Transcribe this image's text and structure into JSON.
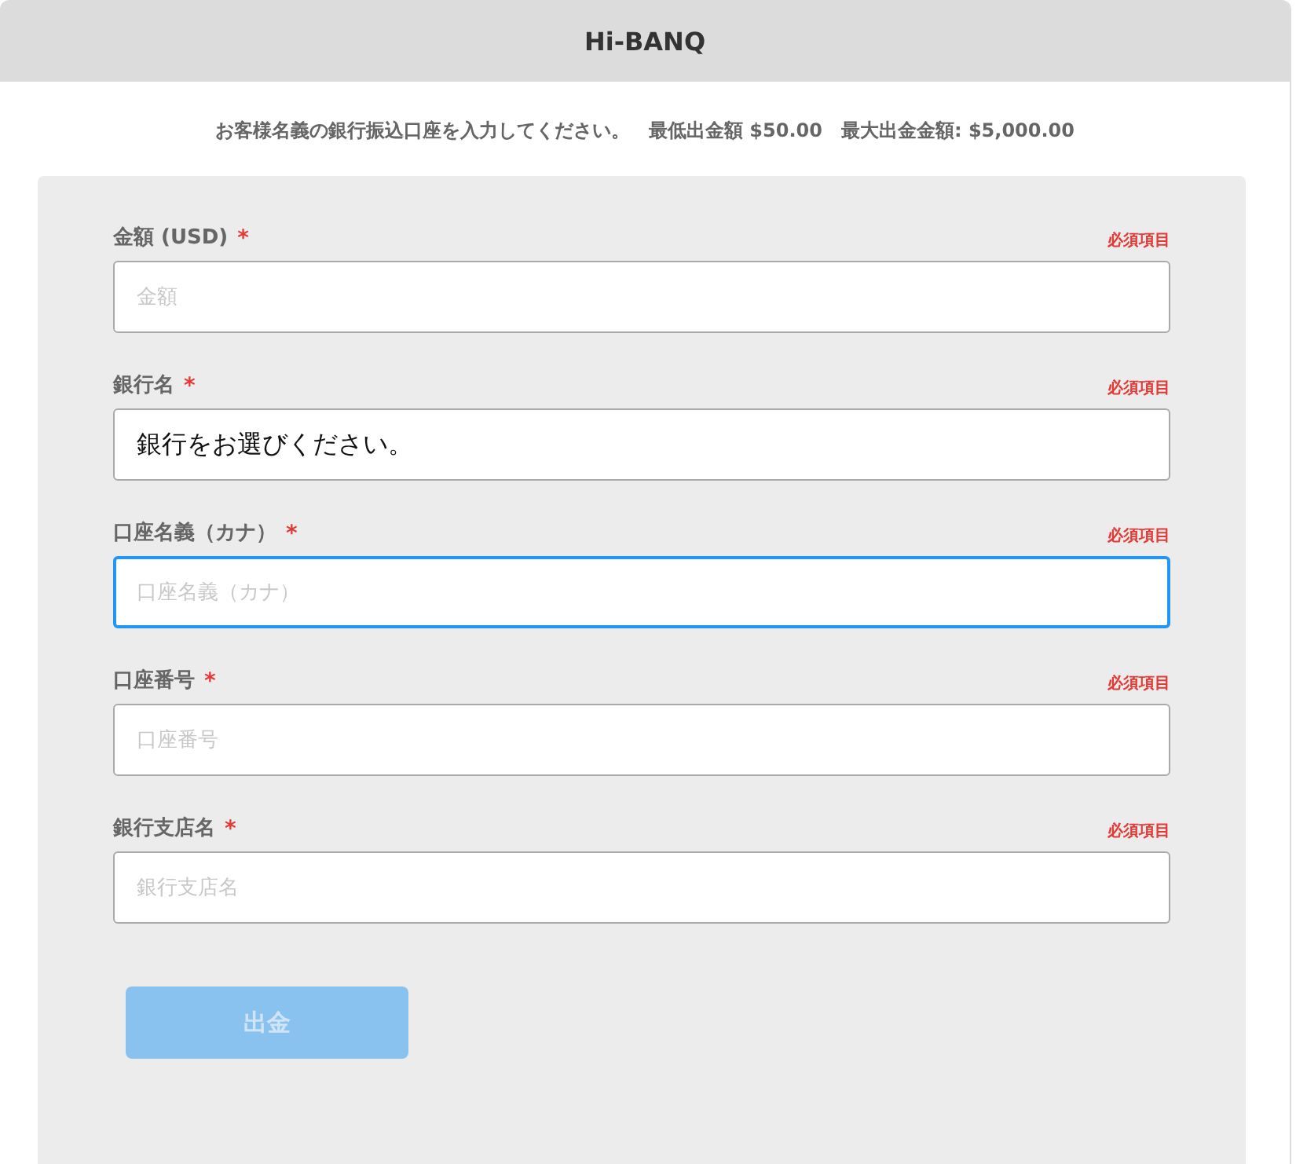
{
  "window": {
    "title": "Hi-BANQ"
  },
  "instructions": "お客様名義の銀行振込口座を入力してください。　最低出金額 $50.00　最大出金金額: $5,000.00",
  "fields": [
    {
      "label": "金額 (USD)",
      "required_mark": "*",
      "required_note": "必須項目",
      "placeholder": "金額",
      "focused": false
    },
    {
      "label": "銀行名",
      "required_mark": "*",
      "required_note": "必須項目",
      "value": "銀行をお選びください。",
      "focused": false
    },
    {
      "label": "口座名義（カナ）",
      "required_mark": "*",
      "required_note": "必須項目",
      "placeholder": "口座名義（カナ）",
      "focused": true
    },
    {
      "label": "口座番号",
      "required_mark": "*",
      "required_note": "必須項目",
      "placeholder": "口座番号",
      "focused": false
    },
    {
      "label": "銀行支店名",
      "required_mark": "*",
      "required_note": "必須項目",
      "placeholder": "銀行支店名",
      "focused": false
    }
  ],
  "submit": {
    "label": "出金",
    "disabled": true
  }
}
